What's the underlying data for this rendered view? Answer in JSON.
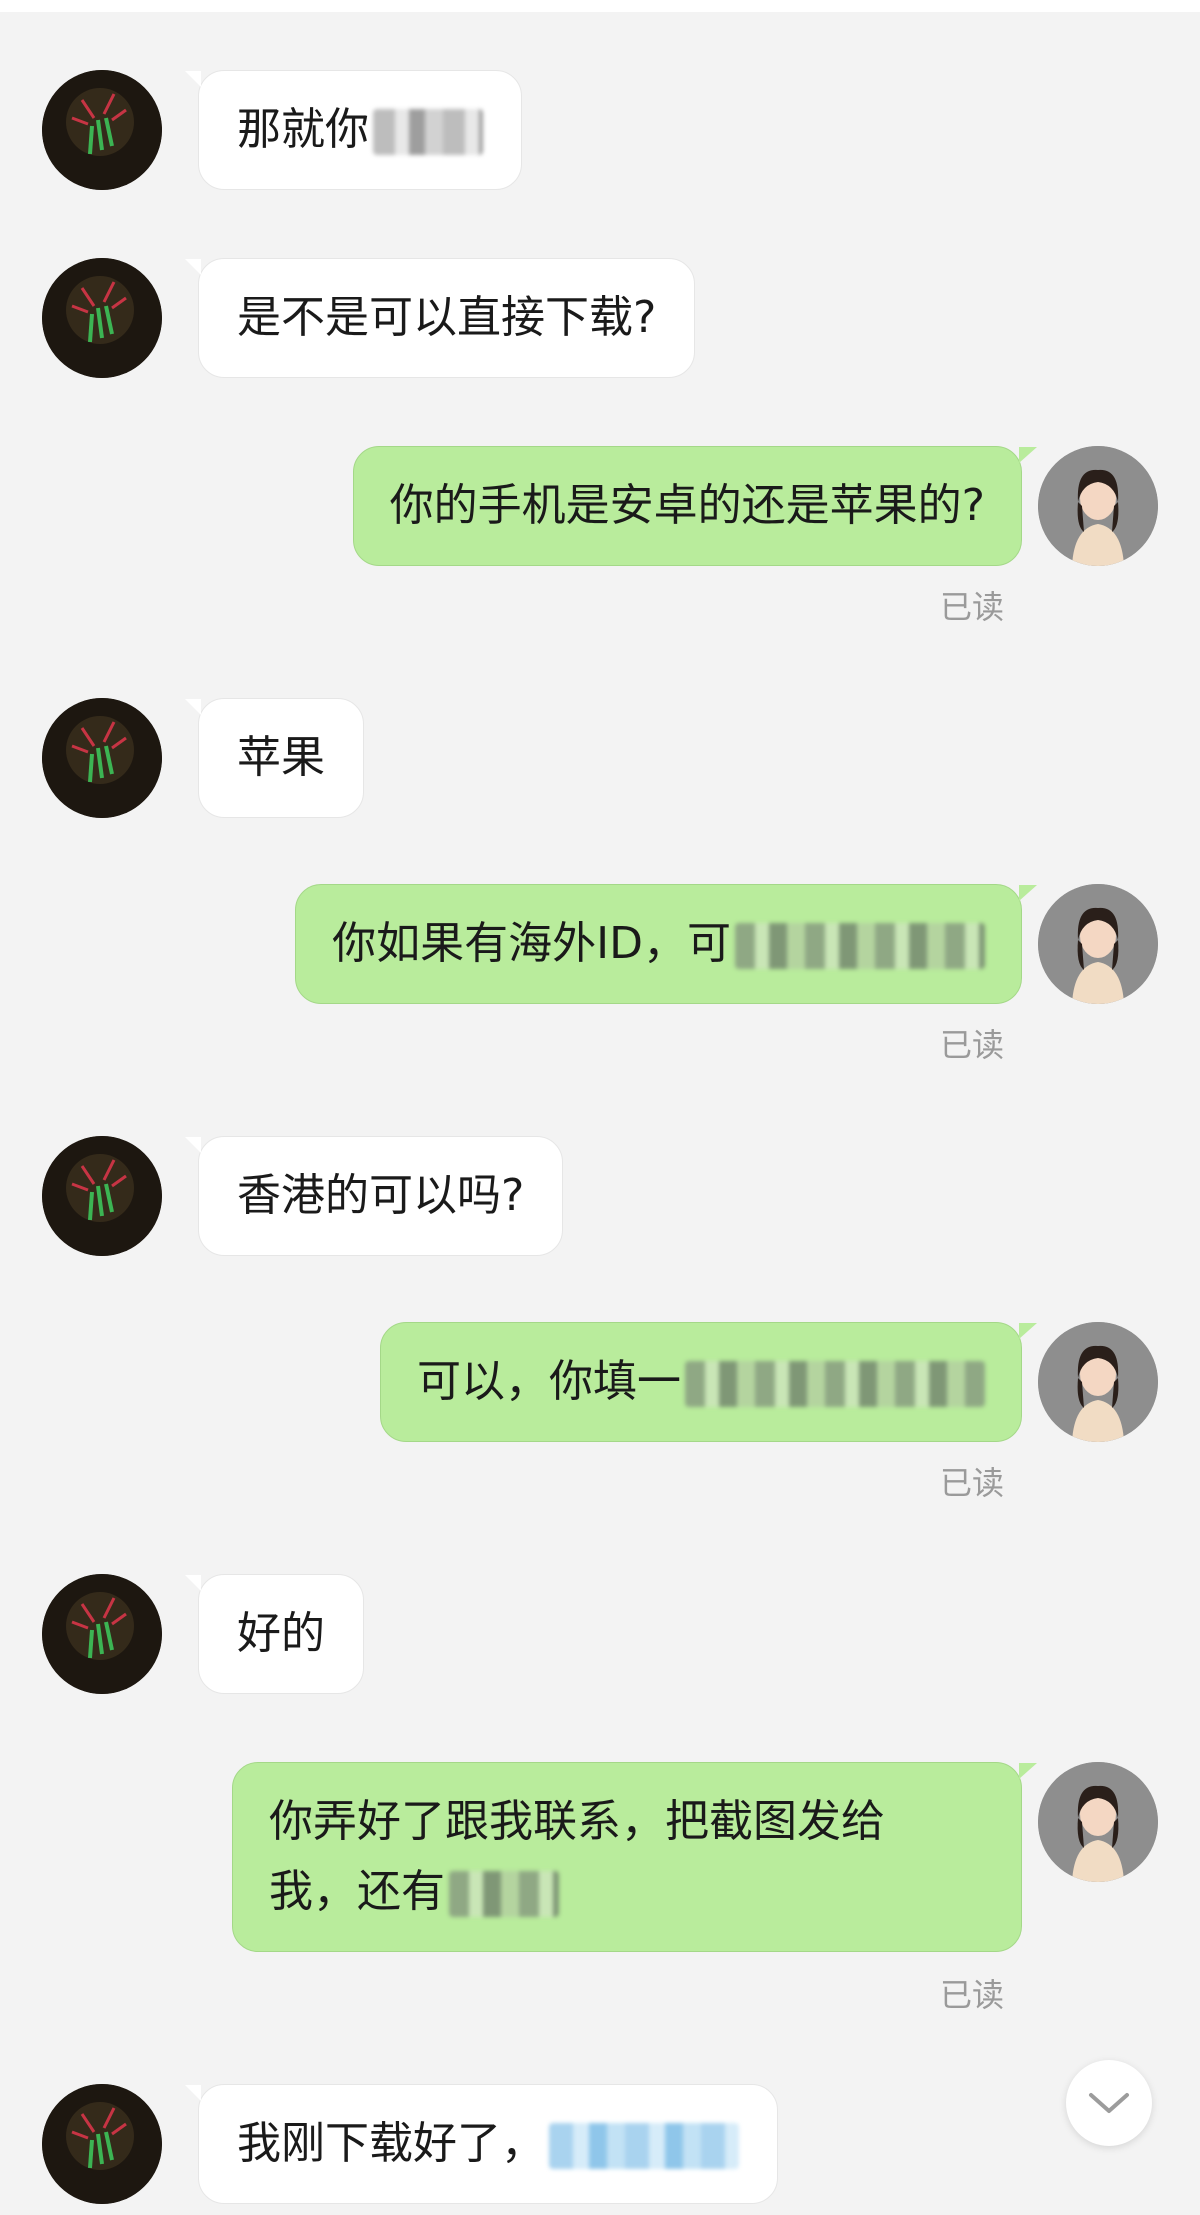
{
  "messages": [
    {
      "side": "left",
      "text": "那就你",
      "redacted": true
    },
    {
      "side": "left",
      "text": "是不是可以直接下载?",
      "redacted": true
    },
    {
      "side": "right",
      "text": "你的手机是安卓的还是苹果的?",
      "status": "已读"
    },
    {
      "side": "left",
      "text": "苹果"
    },
    {
      "side": "right",
      "text": "你如果有海外ID，可",
      "redacted": true,
      "status": "已读"
    },
    {
      "side": "left",
      "text": "香港的可以吗?"
    },
    {
      "side": "right",
      "text": "可以，你填一",
      "redacted": true,
      "status": "已读"
    },
    {
      "side": "left",
      "text": "好的"
    },
    {
      "side": "right",
      "text": "你弄好了跟我联系，把截图发给",
      "text_line2": "我，还有",
      "redacted": true,
      "status": "已读"
    },
    {
      "side": "left",
      "text": "我刚下载好了，",
      "redacted": true
    }
  ],
  "icons": {
    "left_avatar": "firework-avatar",
    "right_avatar": "woman-avatar",
    "scroll": "chevron-down-icon"
  },
  "colors": {
    "background": "#f3f3f3",
    "incoming_bubble": "#ffffff",
    "outgoing_bubble": "#b9ec9c",
    "read_status": "#9a9a9a"
  }
}
